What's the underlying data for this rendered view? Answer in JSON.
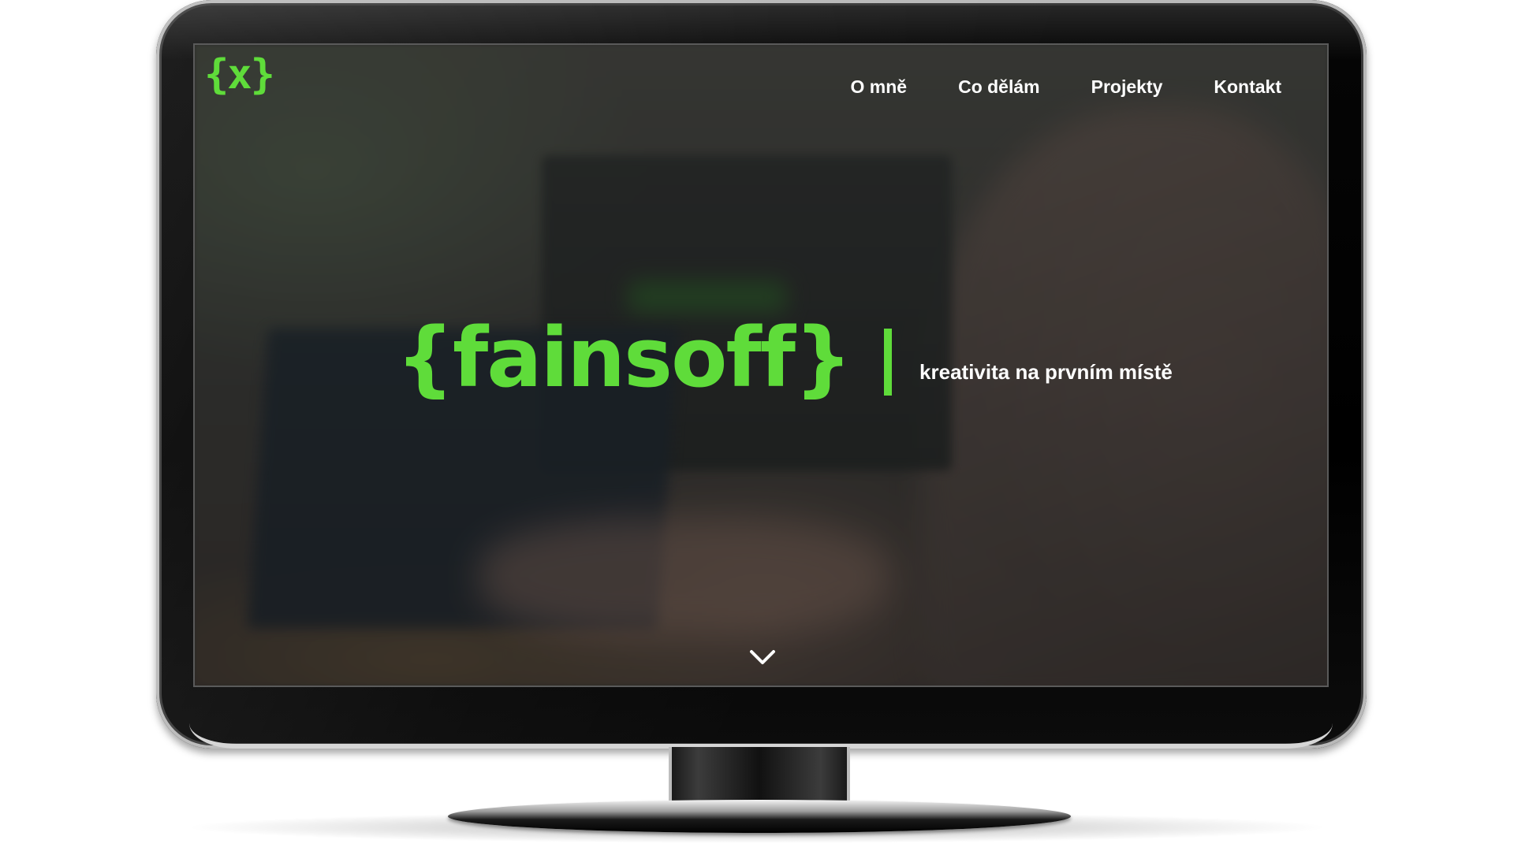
{
  "site": {
    "logo_text": "{x}",
    "nav": {
      "items": [
        {
          "label": "O mně"
        },
        {
          "label": "Co dělám"
        },
        {
          "label": "Projekty"
        },
        {
          "label": "Kontakt"
        }
      ]
    },
    "hero": {
      "brand": "{fainsoff}",
      "tagline": "kreativita na prvním místě"
    }
  },
  "icons": {
    "scroll": "chevron-down-icon",
    "logo": "curly-braces-x-logo"
  },
  "colors": {
    "accent": "#5fdc3a",
    "nav_text": "#ffffff",
    "monitor_frame": "#000000"
  }
}
